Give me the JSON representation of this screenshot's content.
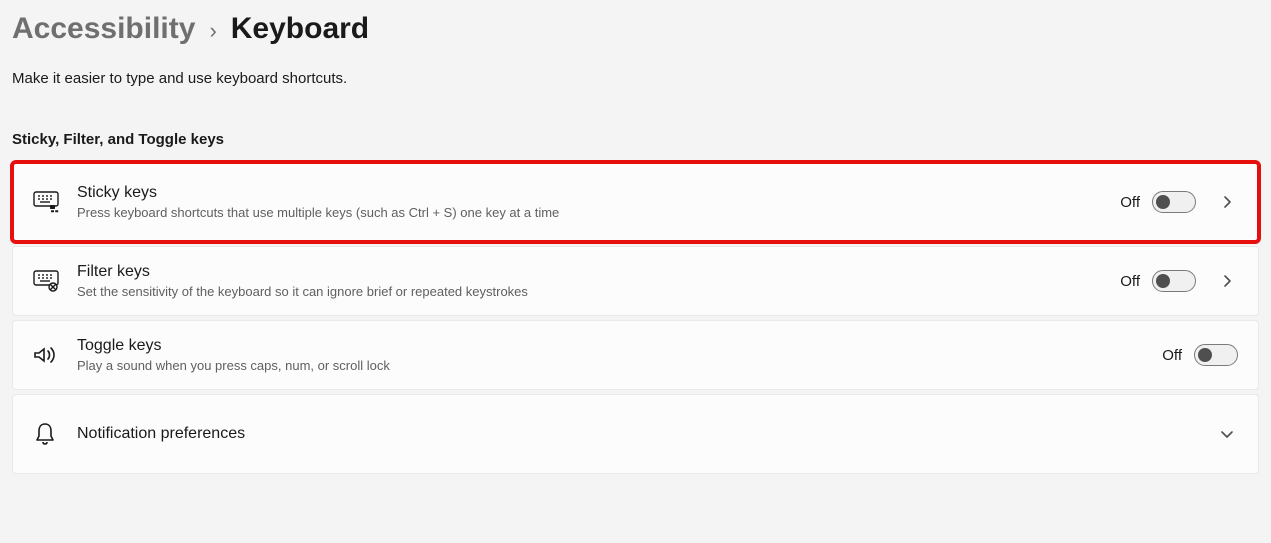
{
  "breadcrumb": {
    "parent": "Accessibility",
    "separator": "›",
    "current": "Keyboard"
  },
  "subtitle": "Make it easier to type and use keyboard shortcuts.",
  "section_heading": "Sticky, Filter, and Toggle keys",
  "items": {
    "sticky_keys": {
      "title": "Sticky keys",
      "desc": "Press keyboard shortcuts that use multiple keys (such as Ctrl + S) one key at a time",
      "state": "Off"
    },
    "filter_keys": {
      "title": "Filter keys",
      "desc": "Set the sensitivity of the keyboard so it can ignore brief or repeated keystrokes",
      "state": "Off"
    },
    "toggle_keys": {
      "title": "Toggle keys",
      "desc": "Play a sound when you press caps, num, or scroll lock",
      "state": "Off"
    },
    "notification_preferences": {
      "title": "Notification preferences"
    }
  },
  "highlighted_item": "sticky_keys"
}
